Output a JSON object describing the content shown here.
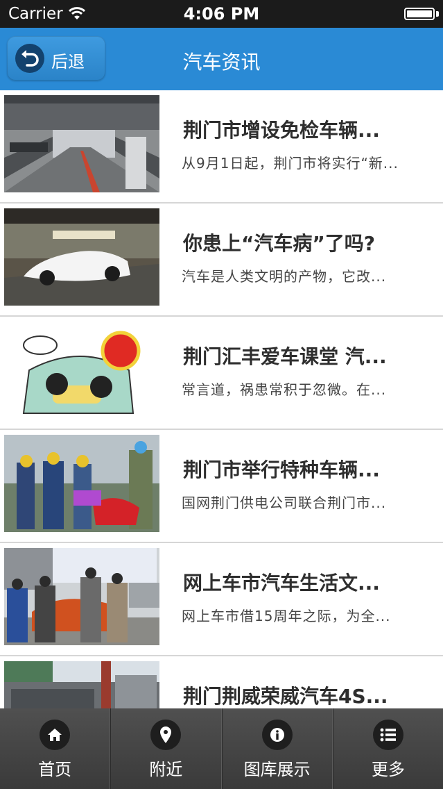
{
  "status_bar": {
    "carrier": "Carrier",
    "time": "4:06 PM"
  },
  "nav": {
    "back_label": "后退",
    "title": "汽车资讯"
  },
  "news": [
    {
      "title": "荆门市增设免检车辆...",
      "summary": "从9月1日起，荆门市将实行“新..."
    },
    {
      "title": "你患上“汽车病”了吗?",
      "summary": "汽车是人类文明的产物，它改..."
    },
    {
      "title": "荆门汇丰爱车课堂 汽...",
      "summary": "常言道，祸患常积于忽微。在..."
    },
    {
      "title": "荆门市举行特种车辆...",
      "summary": "国网荆门供电公司联合荆门市..."
    },
    {
      "title": "网上车市汽车生活文...",
      "summary": "网上车市借15周年之际，为全..."
    },
    {
      "title": "荆门荆威荣威汽车4S...",
      "summary": ""
    }
  ],
  "tabs": [
    {
      "label": "首页",
      "icon": "home-icon"
    },
    {
      "label": "附近",
      "icon": "location-pin-icon"
    },
    {
      "label": "图库展示",
      "icon": "info-icon"
    },
    {
      "label": "更多",
      "icon": "list-icon"
    }
  ],
  "colors": {
    "nav_bar": "#2a8ad5",
    "tab_bar": "#444444",
    "status_bar": "#1b1b1b"
  }
}
